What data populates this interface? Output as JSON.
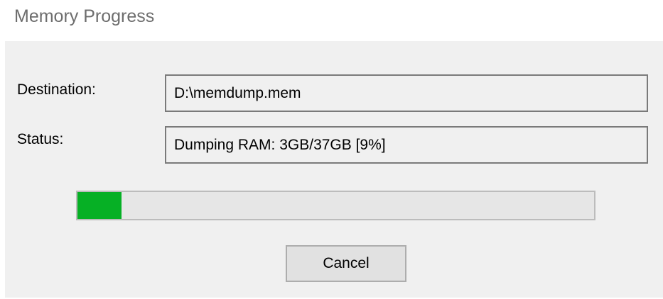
{
  "window": {
    "title": "Memory Progress"
  },
  "fields": {
    "destination_label": "Destination:",
    "destination_value": "D:\\memdump.mem",
    "status_label": "Status:",
    "status_value": "Dumping RAM: 3GB/37GB [9%]"
  },
  "progress": {
    "fraction": 0.085,
    "color": "#06b025"
  },
  "buttons": {
    "cancel_label": "Cancel"
  }
}
